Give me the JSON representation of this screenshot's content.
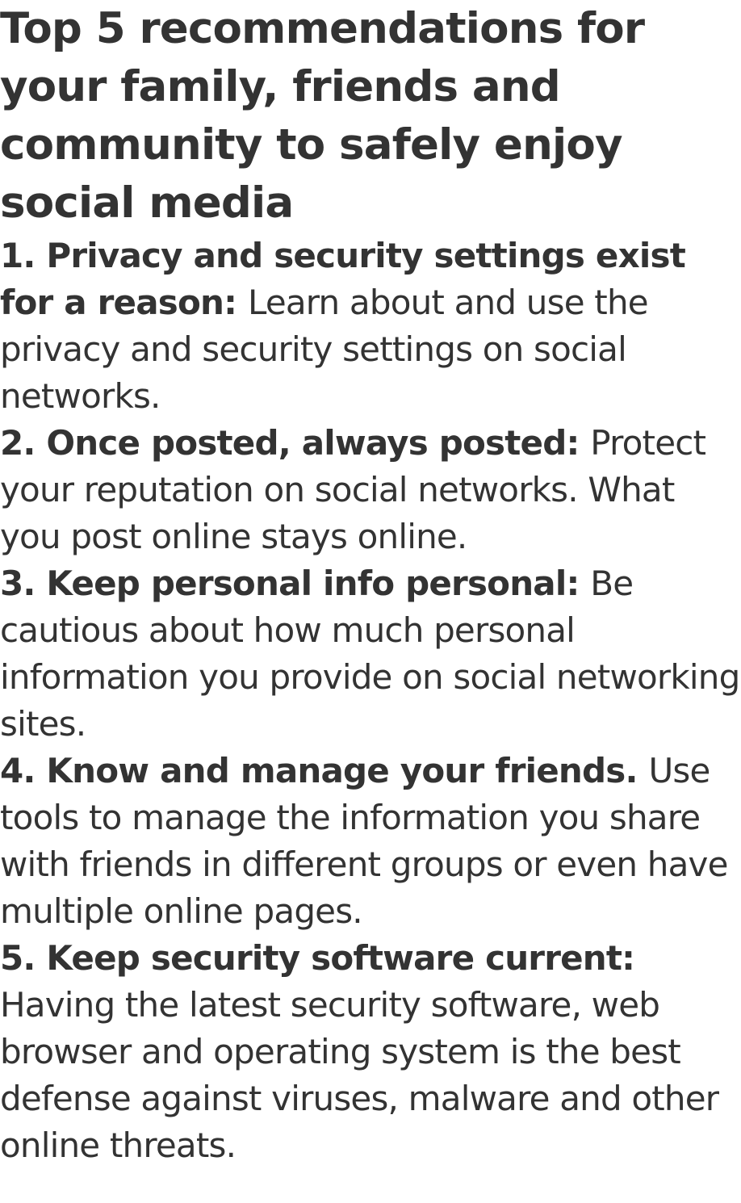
{
  "article": {
    "title": "Top 5 recommendations for your family, friends and community to safely enjoy social media",
    "items": [
      {
        "lead": "1. Privacy and security settings exist for a reason:",
        "body": "Learn about and use the privacy and security settings on social networks."
      },
      {
        "lead": "2. Once posted, always posted:",
        "body": "Protect your reputation on social networks. What you post online stays online."
      },
      {
        "lead": "3. Keep personal info personal:",
        "body": "Be cautious about how much personal information you provide on social networking sites."
      },
      {
        "lead": "4. Know and manage your friends.",
        "body": "Use tools to manage the information you share with friends in different groups or even have multiple online pages."
      },
      {
        "lead": "5. Keep security software current:",
        "body": "Having the latest security software, web browser and operating system is the best defense against viruses, malware and other online threats."
      }
    ]
  }
}
